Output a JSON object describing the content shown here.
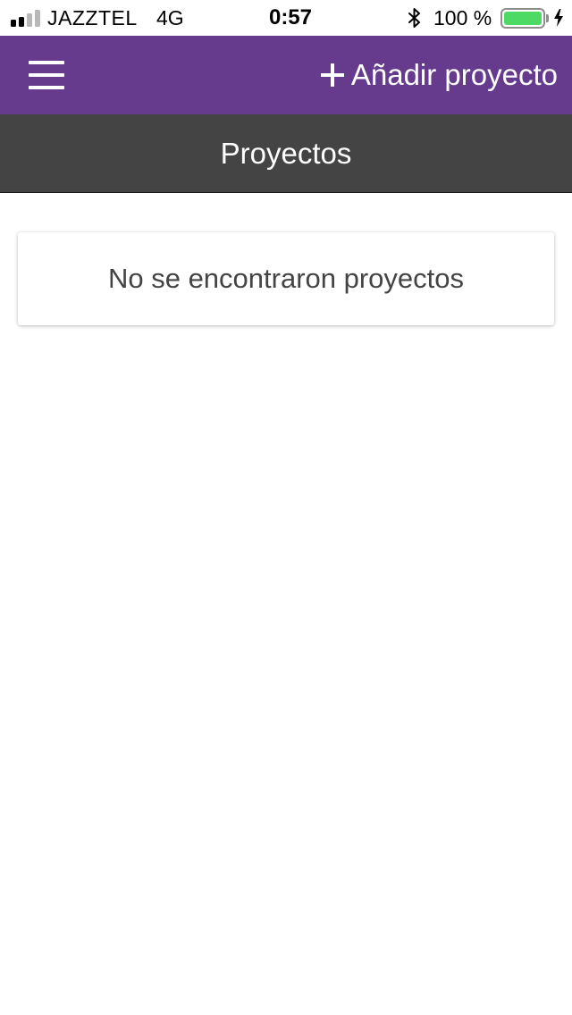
{
  "status_bar": {
    "carrier": "JAZZTEL",
    "network": "4G",
    "time": "0:57",
    "battery_percent": "100 %",
    "battery_level": 1.0,
    "signal_bars_active": 2,
    "signal_bars_total": 4,
    "icons": [
      "signal-icon",
      "bluetooth-icon",
      "battery-icon",
      "charging-icon"
    ]
  },
  "header": {
    "menu_icon": "hamburger-icon",
    "add_project_label": "Añadir proyecto",
    "add_icon": "plus-icon"
  },
  "sub_header": {
    "title": "Proyectos"
  },
  "content": {
    "empty_message": "No se encontraron proyectos"
  },
  "colors": {
    "header_bg": "#663a8c",
    "subheader_bg": "#444444",
    "battery_fill": "#4cd964",
    "signal_active": "#000000",
    "signal_inactive": "#b8b8b8"
  }
}
